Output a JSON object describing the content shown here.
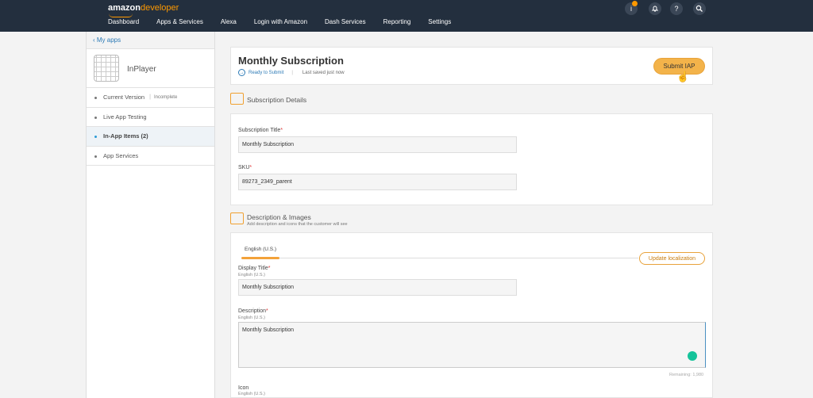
{
  "header": {
    "brand_amazon": "amazon",
    "brand_developer": "developer",
    "nav": [
      "Dashboard",
      "Apps & Services",
      "Alexa",
      "Login with Amazon",
      "Dash Services",
      "Reporting",
      "Settings"
    ],
    "icons": [
      "info-icon",
      "bell-icon",
      "help-icon",
      "search-icon"
    ]
  },
  "sidebar": {
    "back_label": "My apps",
    "app_name": "InPlayer",
    "items": [
      {
        "label": "Current Version",
        "sub": "Incomplete"
      },
      {
        "label": "Live App Testing"
      },
      {
        "label": "In-App Items (2)",
        "active": true
      },
      {
        "label": "App Services"
      }
    ]
  },
  "main": {
    "title": "Monthly Subscription",
    "status": "Ready to Submit",
    "saved": "Last saved just now",
    "submit_label": "Submit IAP",
    "details": {
      "heading": "Subscription Details",
      "title_label": "Subscription Title",
      "title_value": "Monthly Subscription",
      "sku_label": "SKU",
      "sku_value": "89273_2349_parent"
    },
    "description": {
      "heading": "Description & Images",
      "subheading": "Add description and icons that the customer will see",
      "lang_tab": "English (U.S.)",
      "update_label": "Update localization",
      "display_title_label": "Display Title",
      "display_title_sub": "English (U.S.)",
      "display_title_value": "Monthly Subscription",
      "desc_label": "Description",
      "desc_sub": "English (U.S.)",
      "desc_value": "Monthly Subscription",
      "remaining": "Remaining: 1,980",
      "icon_label": "Icon",
      "icon_sub": "English (U.S.)"
    }
  },
  "colors": {
    "accent": "#f3b34a",
    "nav_bg": "#232f3e",
    "link": "#2c7ab6"
  }
}
